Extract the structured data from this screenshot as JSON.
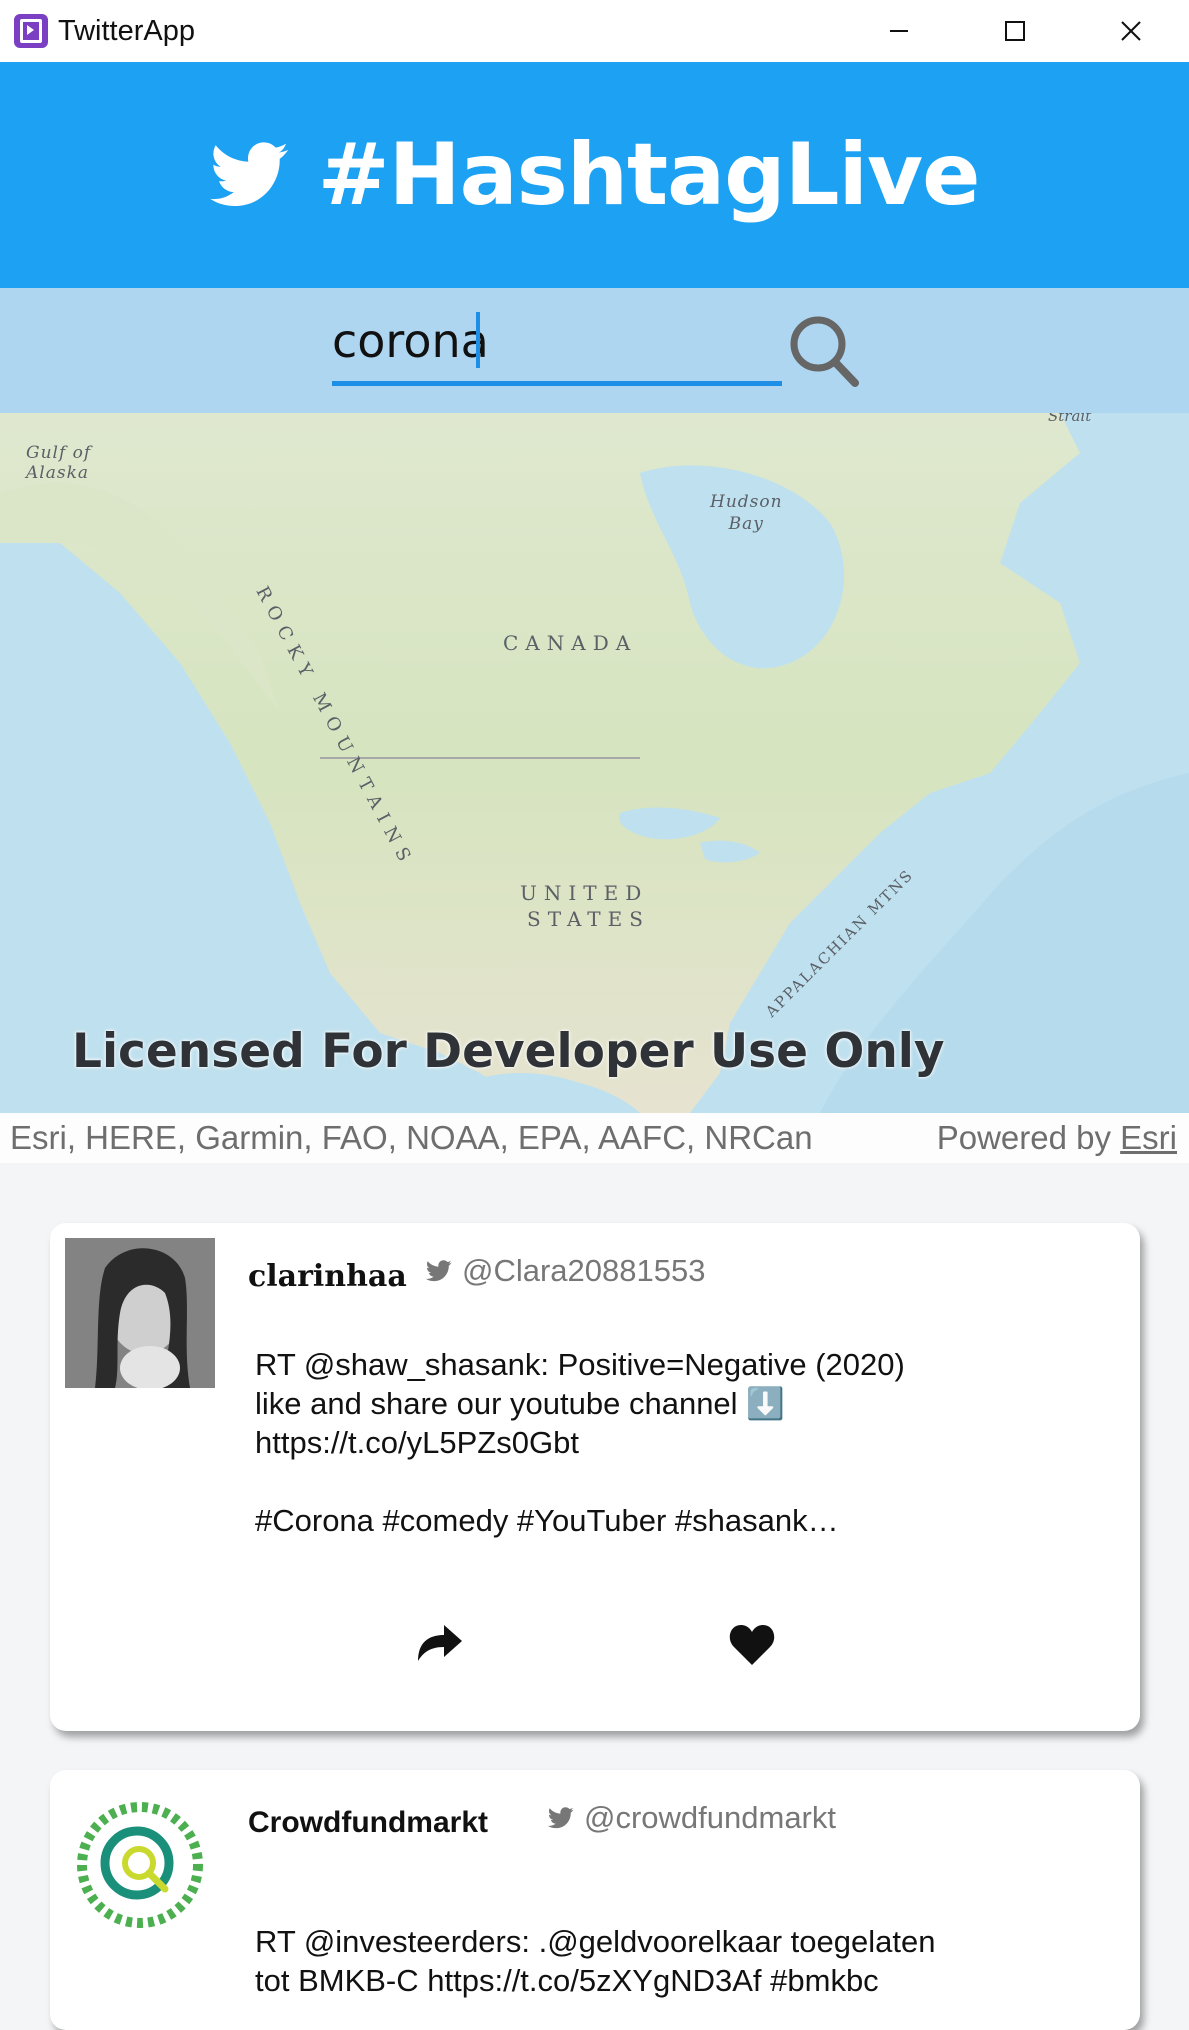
{
  "window": {
    "title": "TwitterApp",
    "minimize": "─",
    "maximize": "☐",
    "close": "✕"
  },
  "header": {
    "title": "#HashtagLive",
    "color": "#1da1f2"
  },
  "search": {
    "value": "corona",
    "placeholder": ""
  },
  "map": {
    "labels": {
      "gulf": "Gulf of\nAlaska",
      "hudson": "Hudson\nBay",
      "canada": "CANADA",
      "rocky": "ROCKY MOUNTAINS",
      "us_line1": "UNITED",
      "us_line2": "STATES",
      "appalachian": "APPALACHIAN MTNS",
      "strait": "Strait"
    },
    "watermark": "Licensed For Developer Use Only",
    "attribution": "Esri, HERE, Garmin, FAO, NOAA, EPA, AAFC, NRCan",
    "powered_by": "Powered by",
    "powered_by_link": "Esri"
  },
  "tweets": [
    {
      "name": "clarinhaa",
      "handle": "@Clara20881553",
      "text": "RT @shaw_shasank: Positive=Negative (2020)\nlike and share our youtube channel ⬇️\nhttps://t.co/yL5PZs0Gbt\n\n#Corona #comedy #YouTuber #shasank…",
      "retweet_icon": "share-arrow-icon",
      "like_icon": "heart-icon"
    },
    {
      "name": "Crowdfundmarkt",
      "handle": "@crowdfundmarkt",
      "text": "RT @investeerders: .@geldvoorelkaar toegelaten\ntot BMKB-C https://t.co/5zXYgND3Af #bmkbc"
    }
  ]
}
